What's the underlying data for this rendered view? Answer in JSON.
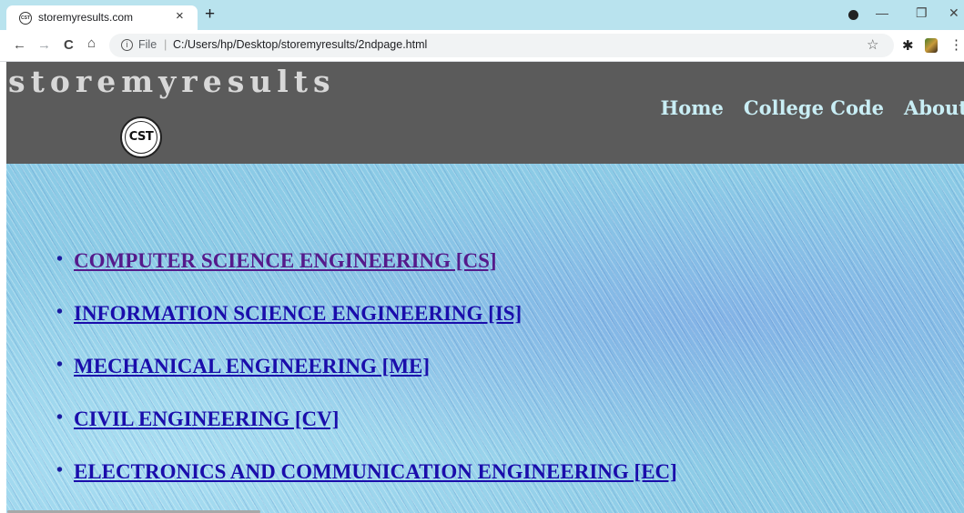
{
  "browser": {
    "tab_title": "storemyresults.com",
    "tab_favicon": "CST",
    "tab_close": "×",
    "new_tab": "+",
    "url_scheme": "File",
    "url_separator": "|",
    "url": "C:/Users/hp/Desktop/storemyresults/2ndpage.html",
    "back": "←",
    "forward": "→",
    "reload": "C",
    "home": "⌂",
    "star": "☆",
    "extensions": "✱",
    "menu": "⋮",
    "minimize": "—",
    "restore": "❐",
    "close": "✕",
    "info": "i"
  },
  "site": {
    "brand": "storemyresults",
    "logo_text": "CST",
    "nav": [
      "Home",
      "College Code",
      "About"
    ]
  },
  "branches": [
    {
      "label": "COMPUTER SCIENCE ENGINEERING [CS]",
      "visited": true
    },
    {
      "label": "INFORMATION SCIENCE ENGINEERING [IS]",
      "visited": false
    },
    {
      "label": "MECHANICAL ENGINEERING [ME]",
      "visited": false
    },
    {
      "label": "CIVIL ENGINEERING [CV]",
      "visited": false
    },
    {
      "label": "ELECTRONICS AND COMMUNICATION ENGINEERING [EC]",
      "visited": false
    }
  ],
  "bullet": "•",
  "colors": {
    "header_bg": "#5b5b5b",
    "nav_link": "#c9eef5",
    "link": "#1a0dab",
    "visited_link": "#551a8b",
    "tabstrip": "#b9e3ee"
  }
}
